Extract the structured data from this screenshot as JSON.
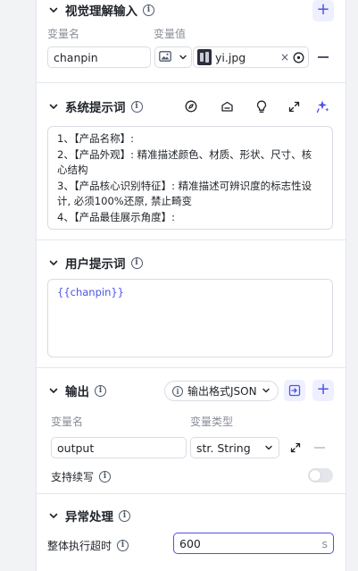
{
  "vision_input": {
    "title": "视觉理解输入",
    "col_var_name": "变量名",
    "col_var_value": "变量值",
    "var_name": "chanpin",
    "file_name": "yi.jpg",
    "clear_symbol": "×"
  },
  "system_prompt": {
    "title": "系统提示词",
    "lines": [
      "1、【产品名称】:",
      "2、【产品外观】: 精准描述颜色、材质、形状、尺寸、核",
      "心结构",
      "3、【产品核心识别特征】: 精准描述可辨识度的标志性设",
      "计, 必须100%还原, 禁止畸变",
      "4、【产品最佳展示角度】:"
    ]
  },
  "user_prompt": {
    "title": "用户提示词",
    "value": "{{chanpin}}"
  },
  "output": {
    "title": "输出",
    "format_label": "输出格式JSON",
    "col_var_name": "变量名",
    "col_var_type": "变量类型",
    "var_name": "output",
    "var_type": "str. String",
    "continue_label": "支持续写",
    "continue_enabled": false
  },
  "exception": {
    "title": "异常处理",
    "timeout_label": "整体执行超时",
    "timeout_value": "600",
    "timeout_unit": "s"
  },
  "colors": {
    "accent": "#4d53e8",
    "accent_bg": "#eef0ff",
    "border": "#d9dce3"
  }
}
